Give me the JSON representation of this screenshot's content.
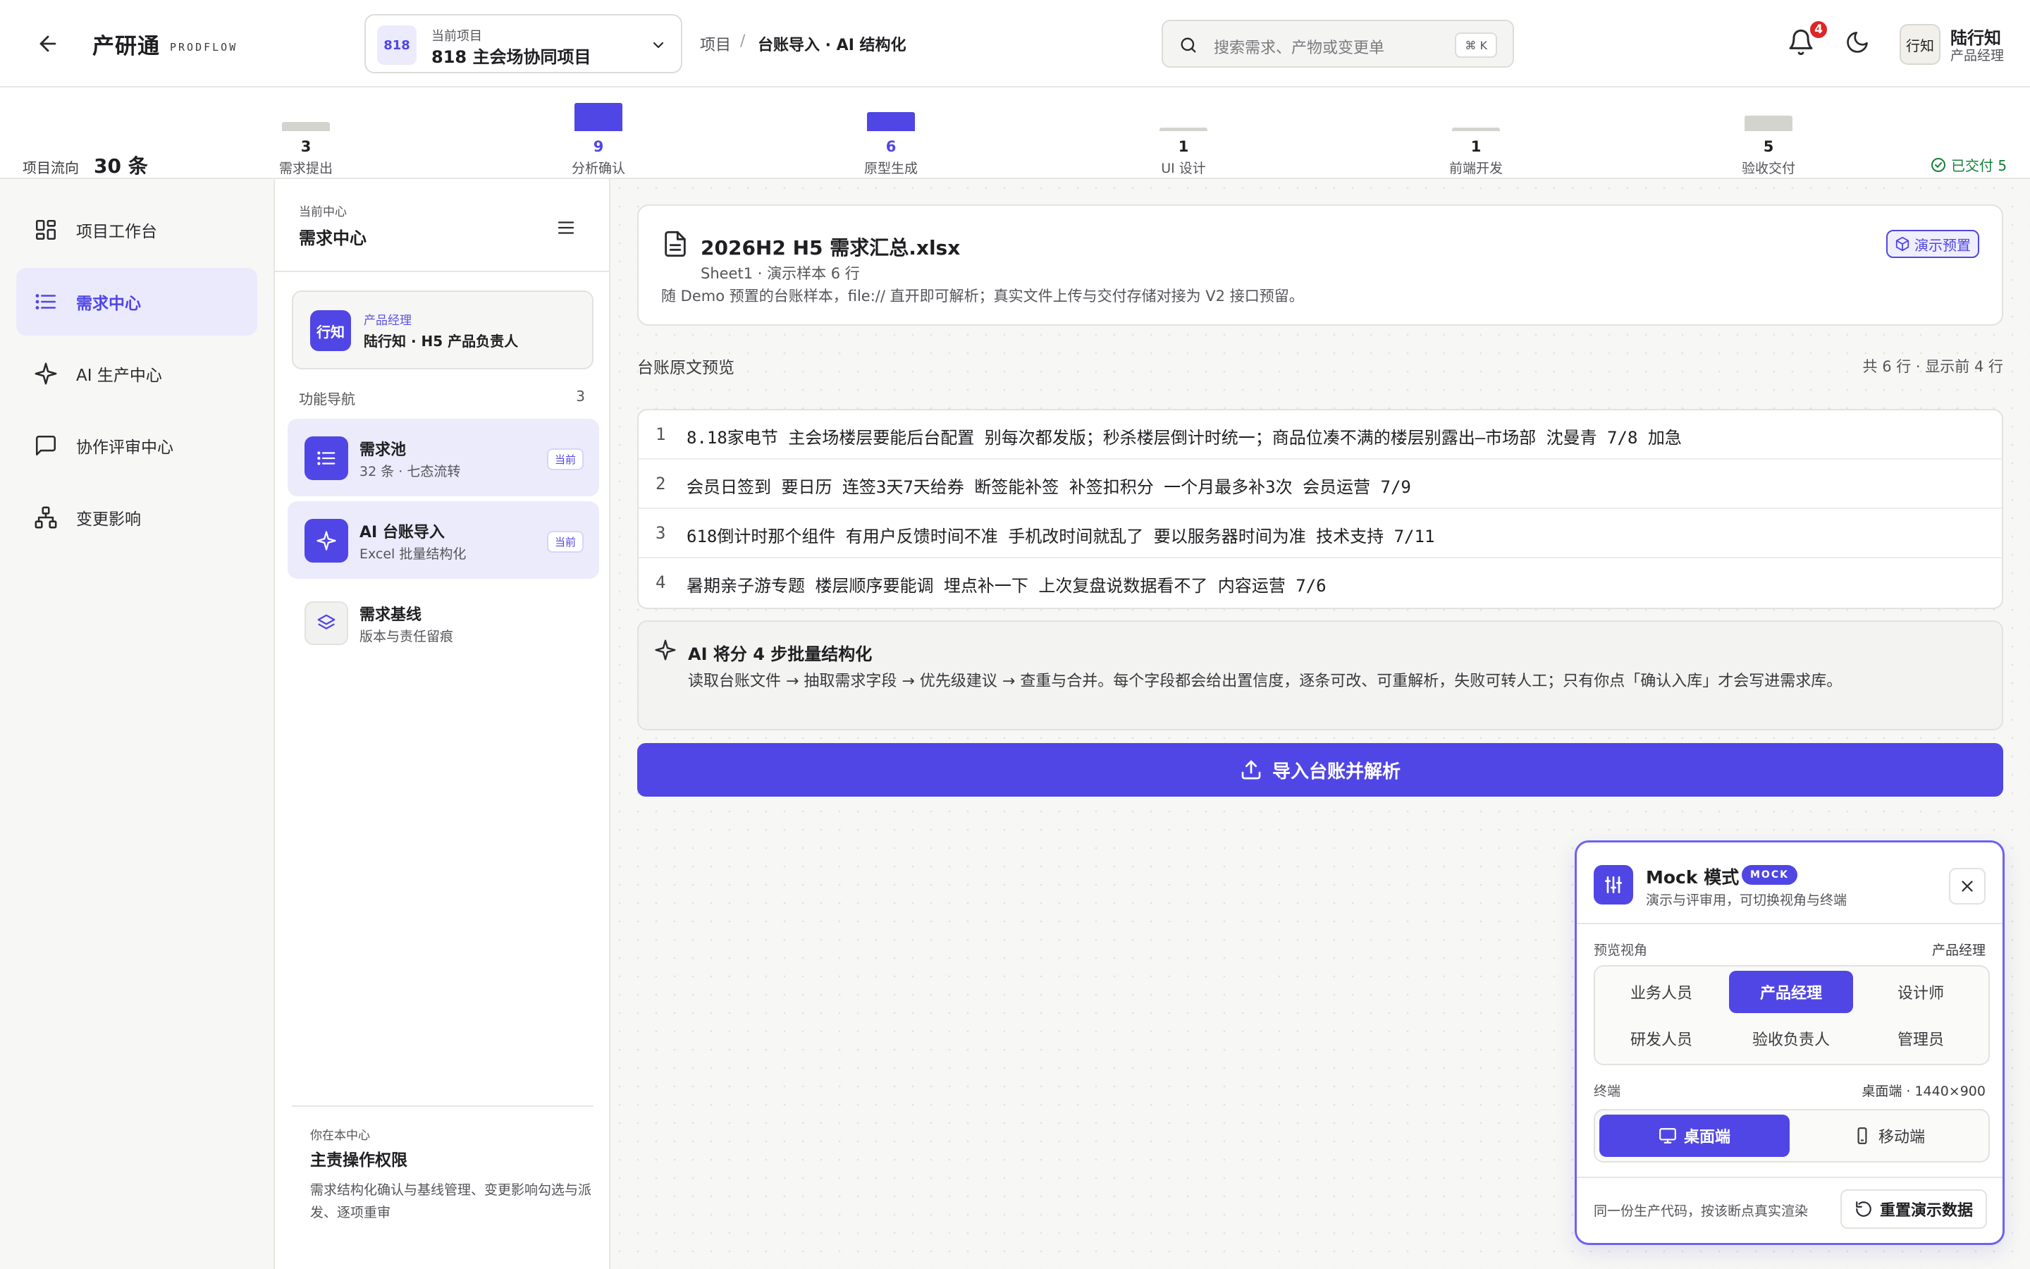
{
  "colors": {
    "accent": "#5046e5",
    "accent_soft": "#ecebfd",
    "success": "#15803d",
    "danger": "#dc2626",
    "bar_idle": "#d4d4cf"
  },
  "header": {
    "brand": "产研通",
    "brand_sub": "PRODFLOW",
    "project": {
      "code": "818",
      "label": "当前项目",
      "name": "818 主会场协同项目"
    },
    "breadcrumb": [
      "项目",
      "台账导入 · AI 结构化"
    ],
    "breadcrumb_sep": "/",
    "search_placeholder": "搜索需求、产物或变更单",
    "search_shortcut": "⌘ K",
    "notification_count": "4",
    "user": {
      "avatar_text": "行知",
      "name": "陆行知",
      "role": "产品经理"
    }
  },
  "flow": {
    "title": "项目流向",
    "total": "30 条",
    "max_count": 9,
    "stages": [
      {
        "label": "需求提出",
        "count": 3,
        "active": false
      },
      {
        "label": "分析确认",
        "count": 9,
        "active": true
      },
      {
        "label": "原型生成",
        "count": 6,
        "active": true
      },
      {
        "label": "UI 设计",
        "count": 1,
        "active": false
      },
      {
        "label": "前端开发",
        "count": 1,
        "active": false
      },
      {
        "label": "验收交付",
        "count": 5,
        "active": false
      }
    ],
    "delivered": "已交付 5"
  },
  "nav": {
    "items": [
      {
        "label": "项目工作台",
        "icon": "grid-icon"
      },
      {
        "label": "需求中心",
        "icon": "list-icon"
      },
      {
        "label": "AI 生产中心",
        "icon": "sparkle-icon"
      },
      {
        "label": "协作评审中心",
        "icon": "chat-icon"
      },
      {
        "label": "变更影响",
        "icon": "hierarchy-icon"
      }
    ]
  },
  "center": {
    "small": "当前中心",
    "title": "需求中心",
    "role_label": "产品经理",
    "role_avatar": "行知",
    "role_name": "陆行知 · H5 产品负责人",
    "fn_title": "功能导航",
    "fn_count": "3",
    "functions": [
      {
        "name": "需求池",
        "desc": "32 条 · 七态流转",
        "badge": "当前"
      },
      {
        "name": "AI 台账导入",
        "desc": "Excel 批量结构化",
        "badge": "当前"
      },
      {
        "name": "需求基线",
        "desc": "版本与责任留痕",
        "badge": ""
      }
    ],
    "foot_small": "你在本中心",
    "foot_title": "主责操作权限",
    "foot_desc": "需求结构化确认与基线管理、变更影响勾选与派发、逐项重审"
  },
  "file": {
    "name": "2026H2 H5 需求汇总.xlsx",
    "meta": "Sheet1 · 演示样本 6 行",
    "desc": "随 Demo 预置的台账样本，file:// 直开即可解析；真实文件上传与交付存储对接为 V2 接口预留。",
    "demo_label": "演示预置"
  },
  "preview": {
    "title": "台账原文预览",
    "count": "共 6 行 · 显示前 4 行",
    "rows": [
      {
        "n": "1",
        "text": "8.18家电节 主会场楼层要能后台配置 别每次都发版；秒杀楼层倒计时统一；商品位凑不满的楼层别露出—市场部 沈曼青 7/8 加急"
      },
      {
        "n": "2",
        "text": "会员日签到 要日历 连签3天7天给券 断签能补签 补签扣积分 一个月最多补3次 会员运营 7/9"
      },
      {
        "n": "3",
        "text": "618倒计时那个组件 有用户反馈时间不准 手机改时间就乱了 要以服务器时间为准 技术支持 7/11"
      },
      {
        "n": "4",
        "text": "暑期亲子游专题 楼层顺序要能调 埋点补一下 上次复盘说数据看不了 内容运营 7/6"
      }
    ]
  },
  "ai": {
    "title": "AI 将分 4 步批量结构化",
    "desc": "读取台账文件 → 抽取需求字段 → 优先级建议 → 查重与合并。每个字段都会给出置信度，逐条可改、可重解析，失败可转人工；只有你点「确认入库」才会写进需求库。"
  },
  "import_button": "导入台账并解析",
  "mock": {
    "title": "Mock 模式",
    "tag": "MOCK",
    "subtitle": "演示与评审用，可切换视角与终端",
    "view_label": "预览视角",
    "view_value": "产品经理",
    "roles": [
      "业务人员",
      "产品经理",
      "设计师",
      "研发人员",
      "验收负责人",
      "管理员"
    ],
    "active_role": 1,
    "terminal_label": "终端",
    "terminal_value": "桌面端 · 1440×900",
    "terminals": [
      "桌面端",
      "移动端"
    ],
    "active_terminal": 0,
    "footer": "同一份生产代码，按该断点真实渲染",
    "reset_label": "重置演示数据"
  }
}
